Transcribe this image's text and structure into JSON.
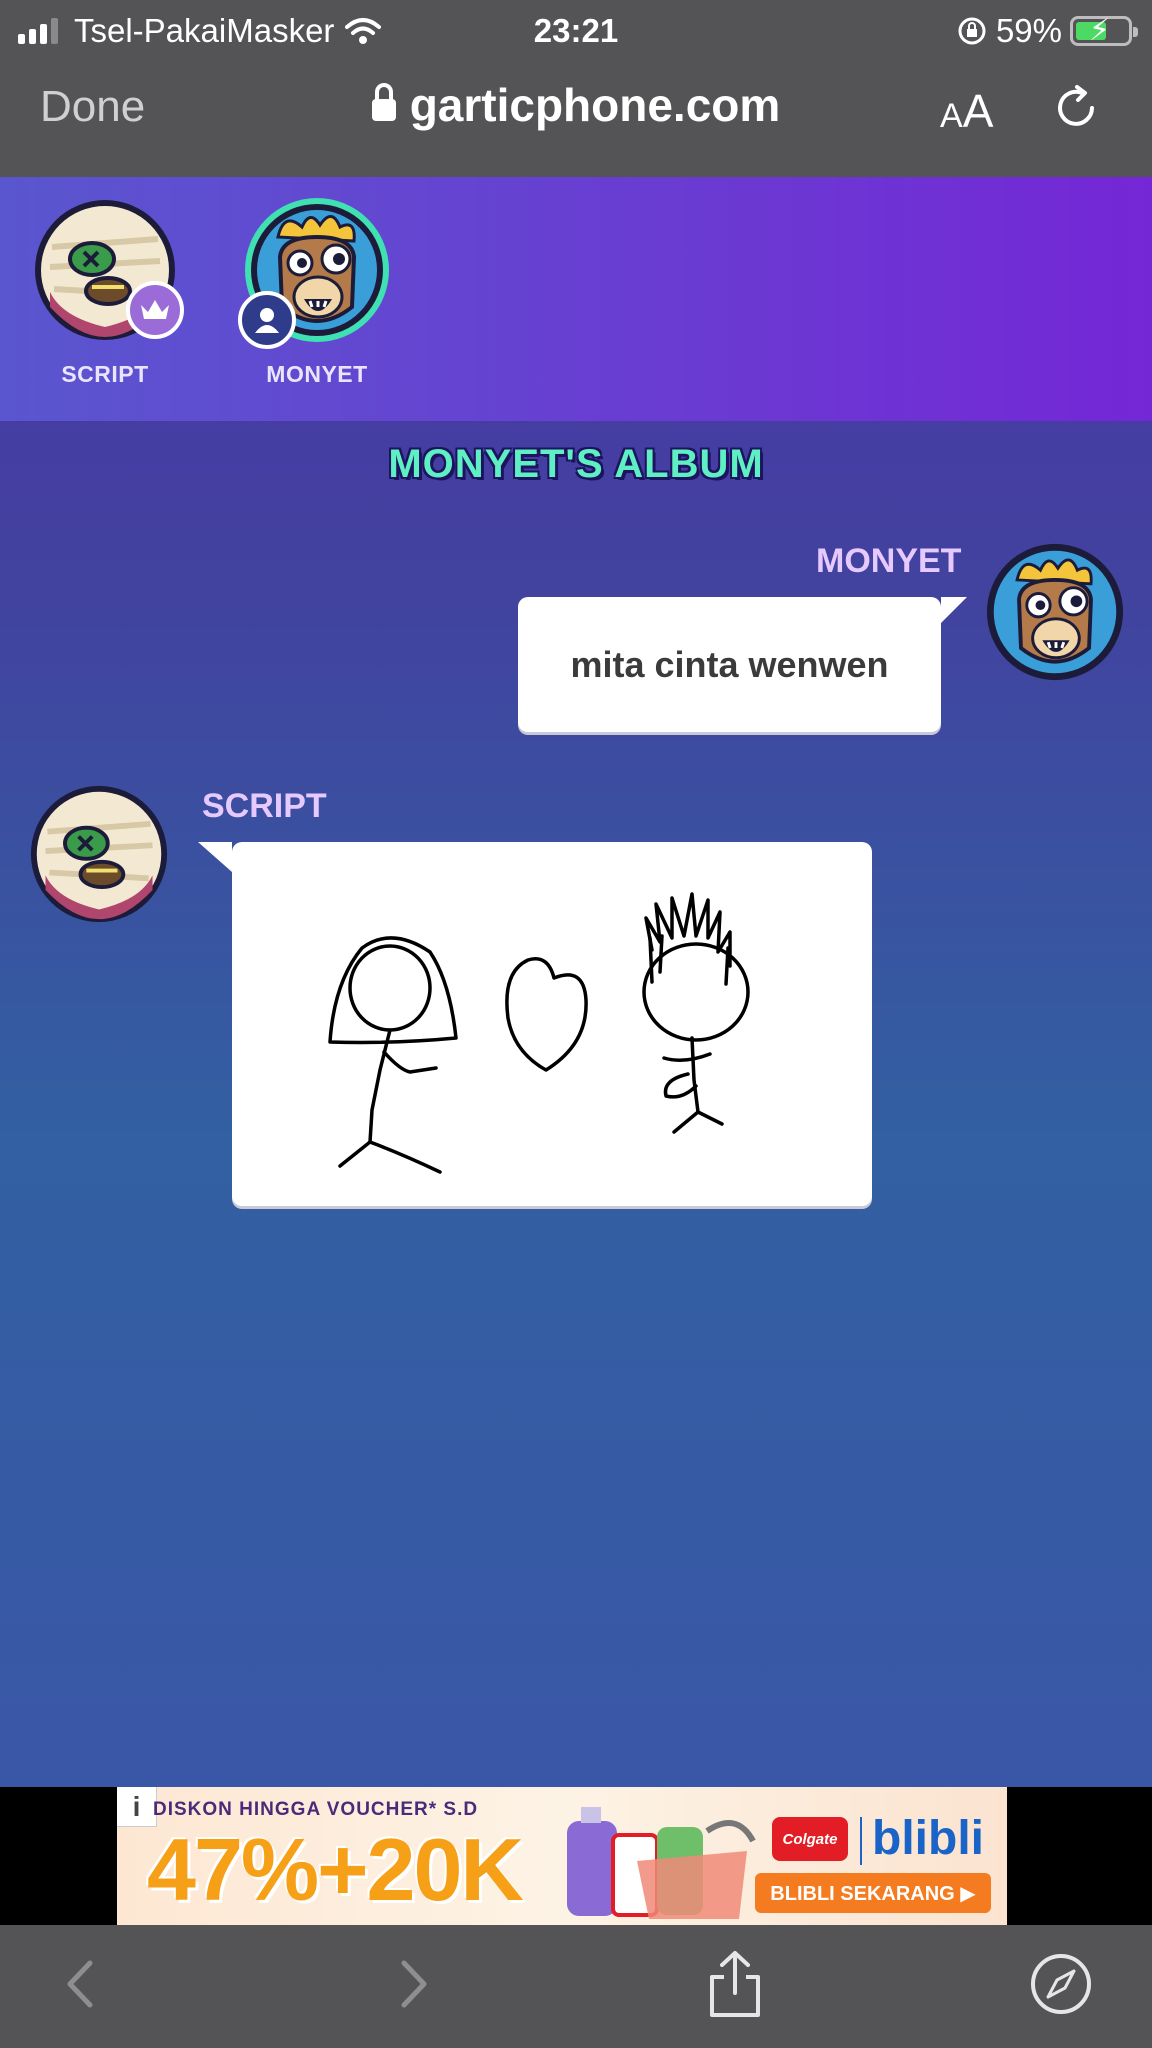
{
  "status_bar": {
    "carrier": "Tsel-PakaiMasker",
    "time": "23:21",
    "battery": "59%",
    "battery_level": 0.59
  },
  "browser": {
    "done_label": "Done",
    "url": "garticphone.com",
    "text_size_small": "A",
    "text_size_big": "A"
  },
  "players": [
    {
      "name": "SCRIPT",
      "avatar": "mummy-avatar",
      "badge": "crown-icon"
    },
    {
      "name": "MONYET",
      "avatar": "llama-avatar",
      "badge": "user-icon"
    }
  ],
  "album": {
    "title": "MONYET'S ALBUM",
    "messages": [
      {
        "author": "MONYET",
        "type": "text",
        "text": "mita cinta wenwen"
      },
      {
        "author": "SCRIPT",
        "type": "drawing",
        "drawing": "two stick figures with a heart between them"
      }
    ]
  },
  "ad": {
    "info": "i",
    "line1": "DISKON HINGGA    VOUCHER* S.D",
    "big": "47%+20K",
    "brand1": "Colgate",
    "brand2": "blibli",
    "cta": "BLIBLI SEKARANG ▶"
  },
  "colors": {
    "album_title": "#5ef0c2",
    "player_name": "#e6c9ff",
    "browser_chrome": "#545456"
  }
}
